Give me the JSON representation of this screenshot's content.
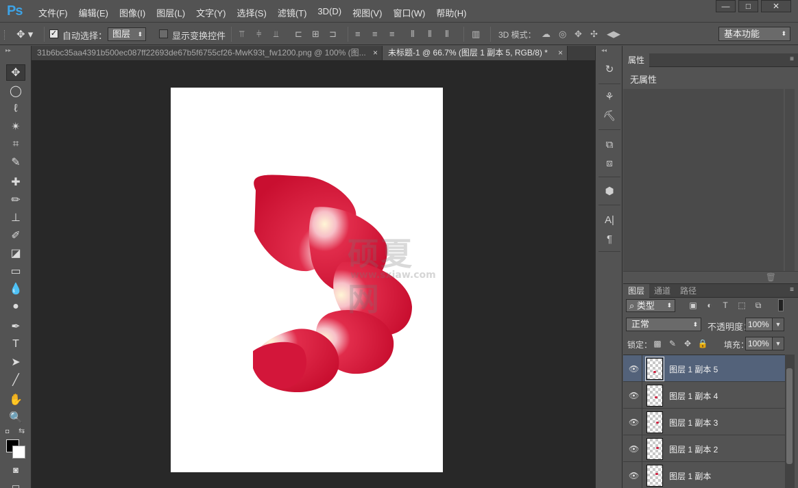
{
  "app": {
    "logo": "Ps"
  },
  "menu": [
    "文件(F)",
    "编辑(E)",
    "图像(I)",
    "图层(L)",
    "文字(Y)",
    "选择(S)",
    "滤镜(T)",
    "3D(D)",
    "视图(V)",
    "窗口(W)",
    "帮助(H)"
  ],
  "window_controls": {
    "minimize": "—",
    "maximize": "□",
    "close": "✕"
  },
  "options_bar": {
    "auto_select_label": "自动选择：",
    "auto_select_checked": true,
    "auto_select_target": "图层",
    "show_transform_label": "显示变换控件",
    "show_transform_checked": false,
    "mode_3d_label": "3D 模式：",
    "workspace": "基本功能"
  },
  "doc_tabs": [
    {
      "title": "31b6bc35aa4391b500ec087ff22693de67b5f6755cf26-MwK93t_fw1200.png @ 100% (图...",
      "close": "×",
      "active": false
    },
    {
      "title": "未标题-1 @ 66.7% (图层 1 副本 5, RGB/8) *",
      "close": "×",
      "active": true
    }
  ],
  "canvas": {
    "background": "#ffffff",
    "watermark": "硕夏网",
    "watermark_sub": "www.sxiaw.com",
    "petal_colors": [
      "#e02045",
      "#c8102e",
      "#f3e8b8"
    ]
  },
  "properties": {
    "tab": "属性",
    "empty_text": "无属性"
  },
  "layers": {
    "tabs": [
      "图层",
      "通道",
      "路径"
    ],
    "filter_type": "类型",
    "blend_mode": "正常",
    "opacity_label": "不透明度：",
    "opacity": "100%",
    "lock_label": "锁定：",
    "fill_label": "填充：",
    "fill": "100%",
    "items": [
      {
        "name": "图层 1 副本 5",
        "selected": true
      },
      {
        "name": "图层 1 副本 4",
        "selected": false
      },
      {
        "name": "图层 1 副本 3",
        "selected": false
      },
      {
        "name": "图层 1 副本 2",
        "selected": false
      },
      {
        "name": "图层 1 副本",
        "selected": false
      }
    ]
  },
  "colors": {
    "foreground": "#000000",
    "background": "#ffffff",
    "accent": "#3da3e6",
    "selection": "#53627a"
  }
}
